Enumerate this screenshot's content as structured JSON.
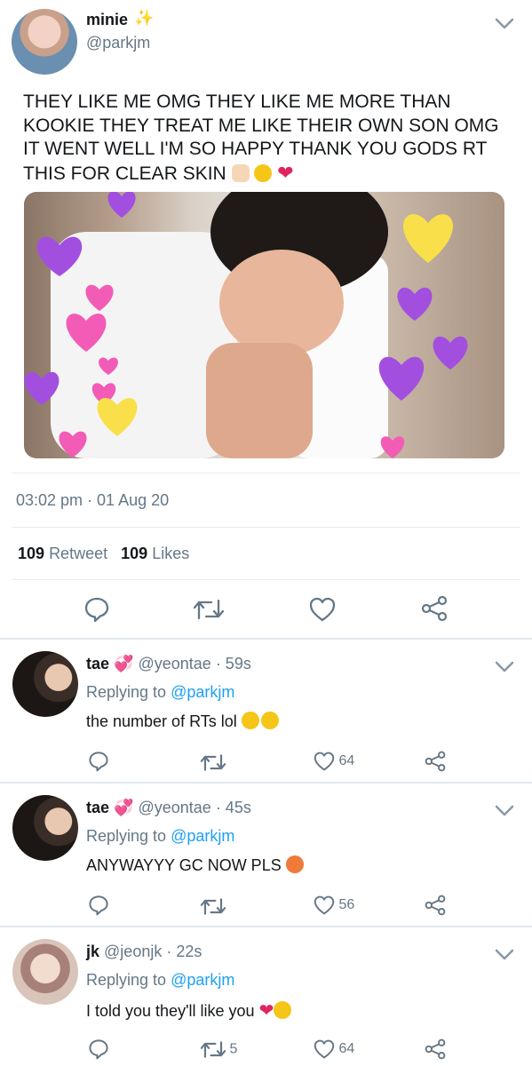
{
  "main_tweet": {
    "name": "minie",
    "handle": "@parkjm",
    "text": "THEY LIKE ME OMG THEY LIKE ME MORE THAN KOOKIE THEY TREAT ME LIKE THEIR OWN SON OMG IT WENT WELL I'M SO HAPPY THANK YOU GODS RT THIS FOR CLEAR SKIN",
    "emojis": [
      "raised-fist-emoji",
      "crying-face-emoji",
      "red-heart-emoji"
    ],
    "timestamp": "03:02 pm · 01 Aug 20",
    "retweets_count": "109",
    "retweets_label": "Retweet",
    "likes_count": "109",
    "likes_label": "Likes"
  },
  "replies": [
    {
      "name": "tae",
      "handle": "@yeontae",
      "time": "· 59s",
      "replying_prefix": "Replying to",
      "replying_handle": "@parkjm",
      "text": "the number of RTs lol",
      "emojis": [
        "rofl-emoji",
        "rofl-emoji"
      ],
      "retweets": "",
      "likes": "64"
    },
    {
      "name": "tae",
      "handle": "@yeontae",
      "time": "· 45s",
      "replying_prefix": "Replying to",
      "replying_handle": "@parkjm",
      "text": "ANYWAYYY GC NOW PLS",
      "emojis": [
        "angry-face-emoji"
      ],
      "retweets": "",
      "likes": "56"
    },
    {
      "name": "jk",
      "handle": "@jeonjk",
      "time": "· 22s",
      "replying_prefix": "Replying to",
      "replying_handle": "@parkjm",
      "text": "I told you they'll like you",
      "emojis": [
        "red-heart-emoji",
        "kissing-face-emoji"
      ],
      "retweets": "5",
      "likes": "64"
    }
  ],
  "colors": {
    "text": "#14171a",
    "secondary": "#657786",
    "link": "#1da1f2",
    "divider": "#e6ecf0"
  }
}
